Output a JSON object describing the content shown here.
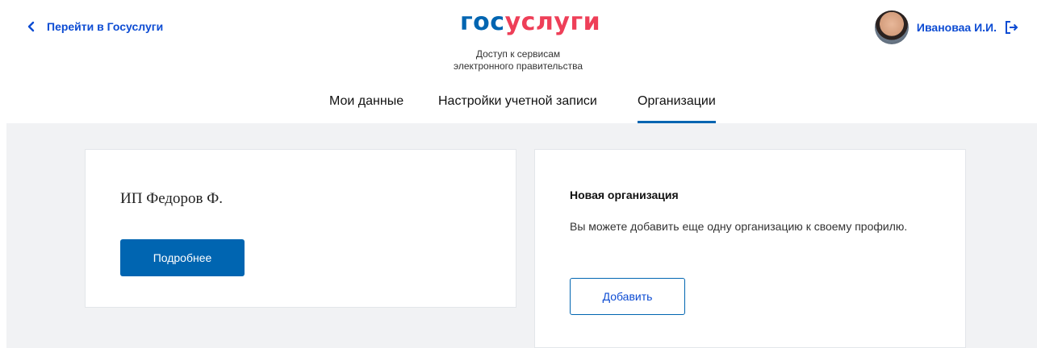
{
  "header": {
    "back_link": "Перейти в Госуслуги",
    "logo_part1": "гос",
    "logo_part2": "услуги",
    "tagline_line1": "Доступ к сервисам",
    "tagline_line2": "электронного правительства",
    "user_name": "Ивановаа И.И."
  },
  "tabs": [
    {
      "label": "Мои данные",
      "active": false
    },
    {
      "label": "Настройки учетной записи",
      "active": false
    },
    {
      "label": "Организации",
      "active": true
    }
  ],
  "organization_card": {
    "name": "ИП Федоров Ф.",
    "details_button": "Подробнее"
  },
  "new_org_card": {
    "title": "Новая организация",
    "description": "Вы можете добавить еще одну организацию к своему профилю.",
    "add_button": "Добавить"
  },
  "colors": {
    "brand_blue": "#0065b1",
    "brand_red": "#ee3f58",
    "link_blue": "#0d4cd3",
    "background_gray": "#f1f2f4"
  },
  "icons": {
    "back": "chevron-left-icon",
    "logout": "logout-icon"
  }
}
